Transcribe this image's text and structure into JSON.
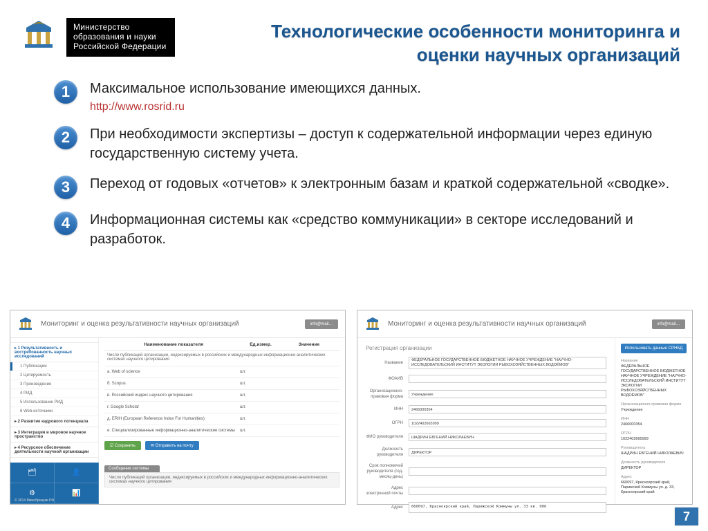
{
  "ministry": {
    "line1": "Министерство",
    "line2": "образования и науки",
    "line3": "Российской Федерации"
  },
  "title": {
    "line1": "Технологические особенности мониторинга и",
    "line2": "оценки научных организаций"
  },
  "points": [
    {
      "num": "1",
      "text": "Максимальное использование имеющихся данных.",
      "link": "http://www.rosrid.ru"
    },
    {
      "num": "2",
      "text": "При необходимости экспертизы – доступ к содержательной информации через единую государственную систему учета."
    },
    {
      "num": "3",
      "text": "Переход от годовых «отчетов» к электронным базам и краткой содержательной «сводке»."
    },
    {
      "num": "4",
      "text": "Информационная системы как «средство коммуникации» в секторе исследований и разработок."
    }
  ],
  "shot_common": {
    "title": "Мониторинг и оценка результативности научных организаций",
    "login": "info@mail…"
  },
  "shot1": {
    "side_header1": "▸ 1 Результативность и востребованность научных исследований",
    "side_pub_active": "1 Публикации",
    "side_items": [
      "2 Цитируемость",
      "3 Произведения",
      "4 РИД",
      "5 Использование РИД",
      "6 Web-источники"
    ],
    "side_header2": "▸ 2 Развитие кадрового потенциала",
    "side_header3": "▸ 3 Интеграция в мировое научное пространство",
    "side_header4": "▸ 4 Ресурсное обеспечение деятельности научной организации",
    "th1": "Наименование показателя",
    "th2": "Ед.измер.",
    "th3": "Значение",
    "desc": "Число публикаций организации, индексируемых в российских и международных информационно-аналитических системах научного цитирования",
    "rows": [
      {
        "label": "а. Web of science",
        "unit": "шт."
      },
      {
        "label": "б. Scopus",
        "unit": "шт."
      },
      {
        "label": "в. Российский индекс научного цитирования",
        "unit": "шт."
      },
      {
        "label": "г. Google Scholar",
        "unit": "шт."
      },
      {
        "label": "д. ERIH (European Reference Index For Humanities)",
        "unit": "шт."
      },
      {
        "label": "е. Специализированные информационно-аналитические системы",
        "unit": "шт."
      }
    ],
    "save_btn": "☑ Сохранить",
    "send_btn": "✉ Отправить на почту",
    "msg_head": "Сообщение системы",
    "msg_body": "Число публикаций организации, индексируемых в российских и международных информационно-аналитических системах научного цитирования",
    "footer": "© 2014 Минобрнауки РФ"
  },
  "shot2": {
    "heading": "Регистрация организации",
    "btn": "Использовать данные СРНБД",
    "fields": {
      "name_lbl": "Название",
      "name_val": "ФЕДЕРАЛЬНОЕ ГОСУДАРСТВЕННОЕ БЮДЖЕТНОЕ НАУЧНОЕ УЧРЕЖДЕНИЕ \"НАУЧНО-ИССЛЕДОВАТЕЛЬСКИЙ ИНСТИТУТ ЭКОЛОГИИ РЫБОХОЗЯЙСТВЕННЫХ ВОДОЁМОВ\"",
      "foaiv_lbl": "ФОАИВ",
      "org_form_lbl": "Организационно-правовая форма",
      "org_form_val": "Учреждение",
      "inn_lbl": "ИНН",
      "inn_val": "2466000354",
      "ogrn_lbl": "ОГРН",
      "ogrn_val": "1022402665999",
      "head_lbl": "ФИО руководителя",
      "head_val": "ШАДРИН ЕВГЕНИЙ НИКОЛАЕВИЧ",
      "post_lbl": "Должность руководителя",
      "post_val": "ДИРЕКТОР",
      "term_lbl": "Срок полномочий руководителя (год-месяц-день)",
      "email_lbl": "Адрес электронной почты",
      "addr_lbl": "Адрес",
      "addr_val": "660097, Красноярский край, Парижской Коммуны ул. 33 кв. 006"
    },
    "side": {
      "name_lbl": "Название",
      "name_val": "ФЕДЕРАЛЬНОЕ ГОСУДАРСТВЕННОЕ БЮДЖЕТНОЕ НАУЧНОЕ УЧРЕЖДЕНИЕ \"НАУЧНО-ИССЛЕДОВАТЕЛЬСКИЙ ИНСТИТУТ ЭКОЛОГИИ РЫБОХОЗЯЙСТВЕННЫХ ВОДОЁМОВ\"",
      "org_form_lbl": "Организационно-правовая форма",
      "org_form_val": "Учреждение",
      "inn_lbl": "ИНН",
      "inn_val": "2466000354",
      "ogrn_lbl": "ОГРН",
      "ogrn_val": "1022402665999",
      "head_lbl": "Руководитель",
      "head_val": "ШАДРИН ЕВГЕНИЙ НИКОЛАЕВИЧ",
      "post_lbl": "Должность руководителя",
      "post_val": "ДИРЕКТОР",
      "addr_lbl": "Адрес",
      "addr_val": "660097, Красноярский край, Парижской Коммуны ул. д. 33, Красноярский край"
    }
  },
  "page_number": "7"
}
